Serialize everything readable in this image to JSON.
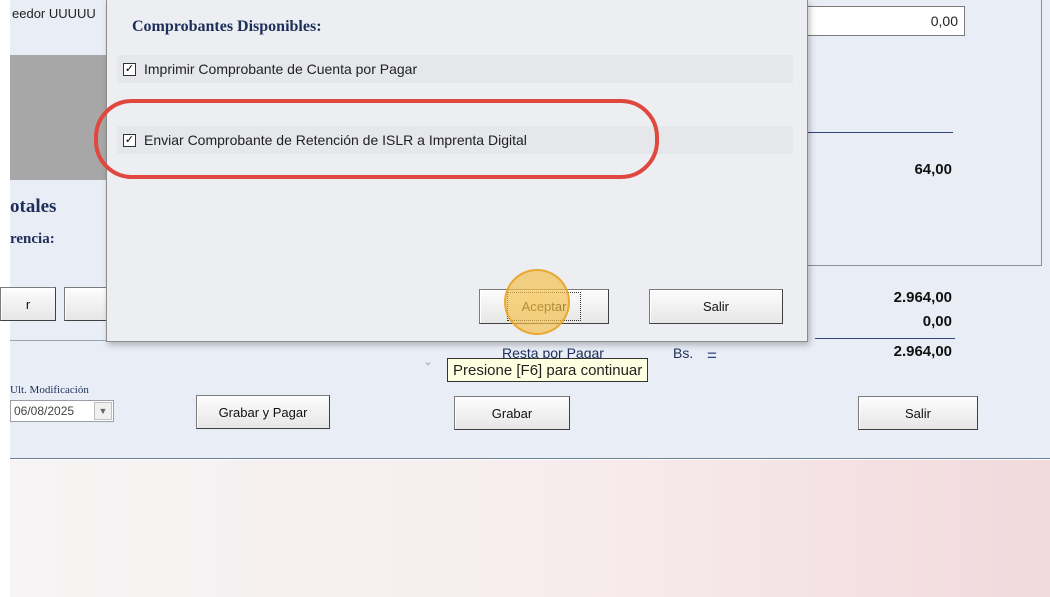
{
  "background": {
    "proveedor_fragment": "eedor UUUUU",
    "totals_heading_fragment": "otales",
    "diferencia_fragment": "rencia:",
    "field_value": "0,00",
    "total_64": "64,00",
    "total_a": "2.964,00",
    "total_b": "0,00",
    "total_c": "2.964,00",
    "resta_label": "Resta por Pagar",
    "currency": "Bs.",
    "equals": "=",
    "ult_mod_label": "Ult. Modificación",
    "ult_mod_date": "06/08/2025",
    "left_btn_fragment": "r",
    "grabar_pagar": "Grabar y Pagar",
    "grabar": "Grabar",
    "salir": "Salir"
  },
  "dialog": {
    "heading": "Comprobantes Disponibles:",
    "options": [
      {
        "label": "Imprimir Comprobante de Cuenta por Pagar",
        "checked": true
      },
      {
        "label": "Enviar Comprobante de Retención de ISLR a Imprenta Digital",
        "checked": true
      }
    ],
    "accept_label": "Aceptar",
    "exit_label": "Salir",
    "tooltip": "Presione [F6] para continuar"
  },
  "colors": {
    "highlight": "#e0473e",
    "heading": "#1c2e5a",
    "cursor": "#f5be46"
  }
}
